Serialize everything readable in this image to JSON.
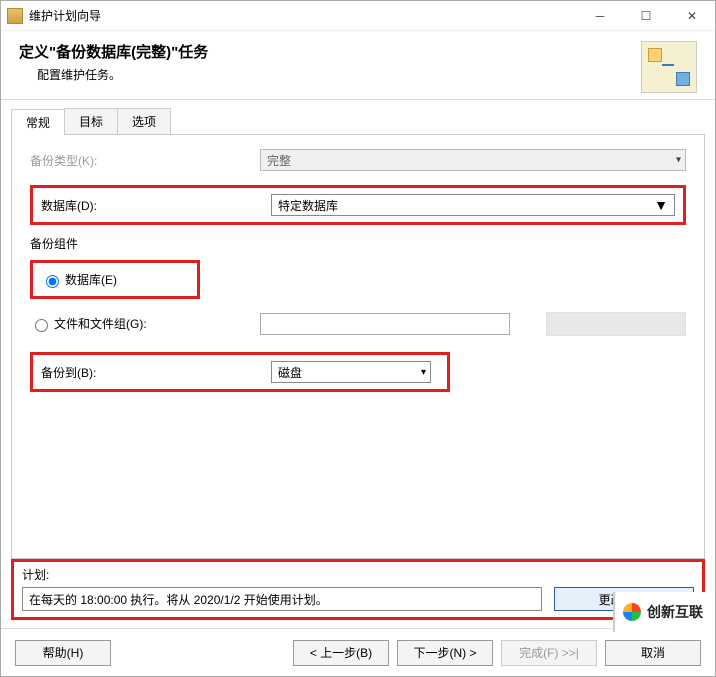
{
  "window": {
    "title": "维护计划向导"
  },
  "header": {
    "title": "定义\"备份数据库(完整)\"任务",
    "subtitle": "配置维护任务。"
  },
  "tabs": {
    "t0": "常规",
    "t1": "目标",
    "t2": "选项"
  },
  "form": {
    "backup_type_label": "备份类型(K):",
    "backup_type_value": "完整",
    "database_label": "数据库(D):",
    "database_value": "特定数据库",
    "component_label": "备份组件",
    "radio_db": "数据库(E)",
    "radio_fg": "文件和文件组(G):",
    "backup_to_label": "备份到(B):",
    "backup_to_value": "磁盘"
  },
  "schedule": {
    "label": "计划:",
    "value": "在每天的 18:00:00 执行。将从 2020/1/2 开始使用计划。",
    "change_btn": "更改(C)..."
  },
  "footer": {
    "help": "帮助(H)",
    "prev": "< 上一步(B)",
    "next": "下一步(N) >",
    "finish": "完成(F) >>|",
    "cancel": "取消"
  },
  "watermark": "创新互联"
}
